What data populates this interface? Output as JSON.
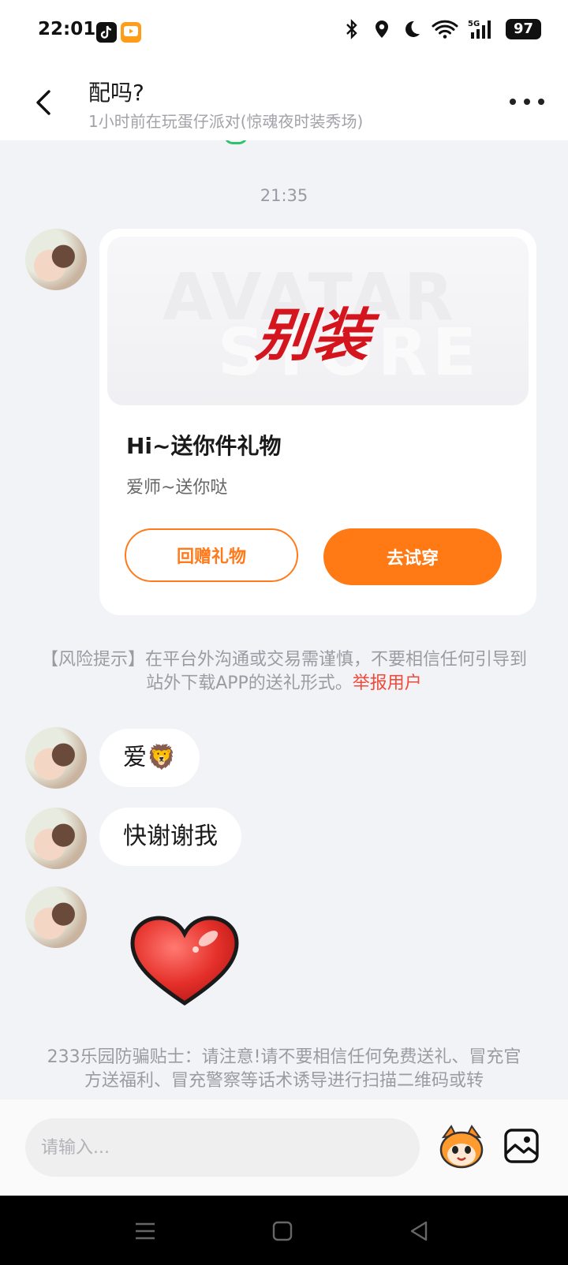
{
  "status_bar": {
    "time": "22:01",
    "battery": "97",
    "icons": [
      "tiktok-icon",
      "app-icon",
      "bluetooth-icon",
      "location-icon",
      "moon-icon",
      "wifi-icon",
      "signal-5g-icon"
    ]
  },
  "header": {
    "title": "配吗?",
    "subtitle": "1小时前在玩蛋仔派对(惊魂夜时装秀场)"
  },
  "chat": {
    "timestamp": "21:35",
    "gift_card": {
      "banner_bg_top": "AVATAR",
      "banner_bg_bottom": "STORE",
      "banner_text": "别装",
      "title": "Hi~送你件礼物",
      "description": "爱师~送你哒",
      "return_gift_label": "回赠礼物",
      "try_on_label": "去试穿"
    },
    "risk_notice": {
      "text": "【风险提示】在平台外沟通或交易需谨慎，不要相信任何引导到站外下载APP的送礼形式。",
      "report_link": "举报用户"
    },
    "messages": [
      {
        "text": "爱🦁"
      },
      {
        "text": "快谢谢我"
      }
    ],
    "fraud_tips": "233乐园防骗贴士：请注意!请不要相信任何免费送礼、冒充官方送福利、冒充警察等话术诱导进行扫描二维码或转"
  },
  "input_bar": {
    "placeholder": "请输入..."
  },
  "colors": {
    "accent": "#ff7a14",
    "link": "#f04a3a",
    "background": "#f2f3f7"
  }
}
